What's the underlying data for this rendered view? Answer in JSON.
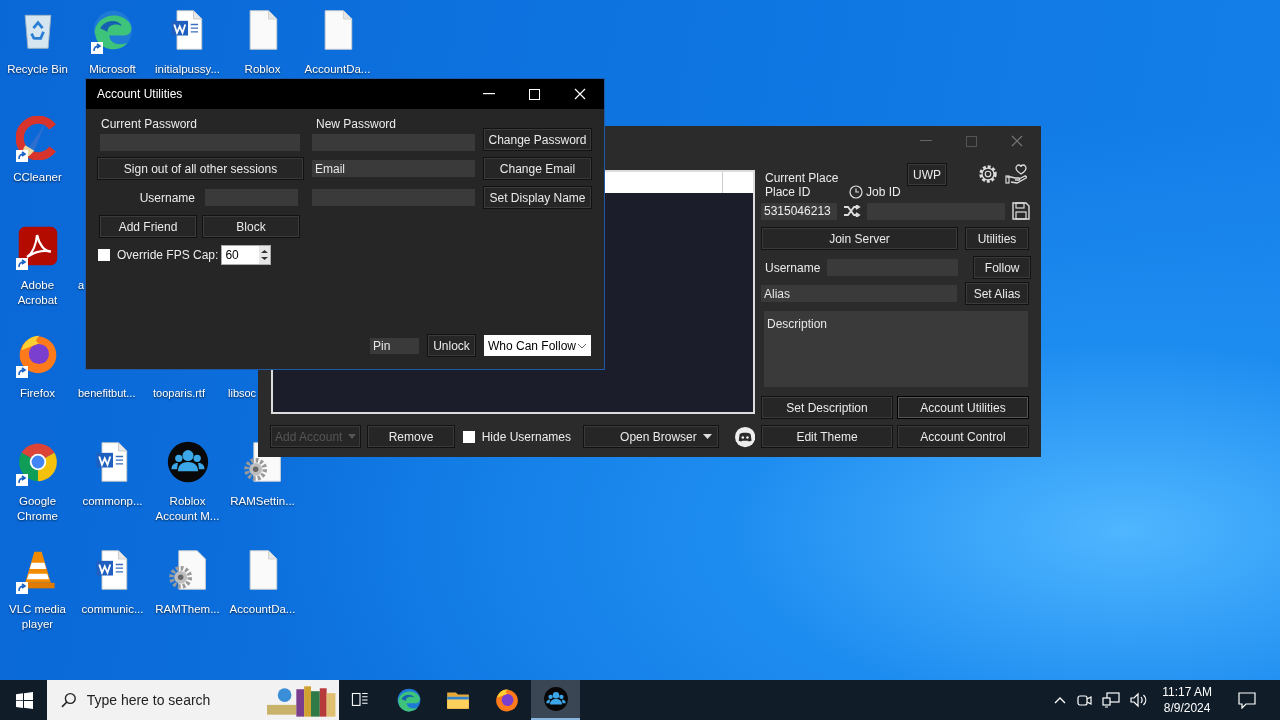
{
  "desktop": {
    "columns": [
      [
        {
          "label": "Recycle Bin",
          "kind": "recycle-bin"
        },
        {
          "label": "CCleaner",
          "kind": "ccleaner",
          "shortcut": true
        },
        {
          "label": "Adobe Acrobat",
          "kind": "acrobat",
          "shortcut": true
        },
        {
          "label": "Firefox",
          "kind": "firefox",
          "shortcut": true
        },
        {
          "label": "Google Chrome",
          "kind": "chrome",
          "shortcut": true
        },
        {
          "label": "VLC media player",
          "kind": "vlc",
          "shortcut": true
        }
      ],
      [
        {
          "label": "Microsoft",
          "kind": "edge",
          "shortcut": true
        },
        {
          "kind": "hidden"
        },
        {
          "label": "a",
          "kind": "hidden"
        },
        {
          "label": "benefitbut...",
          "kind": "hidden"
        },
        {
          "label": "commonp...",
          "kind": "word"
        },
        {
          "label": "communic...",
          "kind": "word"
        }
      ],
      [
        {
          "label": "initialpussy...",
          "kind": "word"
        },
        {
          "kind": "hidden"
        },
        {
          "kind": "hidden"
        },
        {
          "label": "tooparis.rtf",
          "kind": "hidden"
        },
        {
          "label": "Roblox Account M...",
          "kind": "people"
        },
        {
          "label": "RAMThem...",
          "kind": "gear-doc"
        }
      ],
      [
        {
          "label": "Roblox",
          "kind": "doc"
        },
        {
          "kind": "hidden"
        },
        {
          "kind": "hidden"
        },
        {
          "label": "libsoc",
          "kind": "hidden"
        },
        {
          "label": "RAMSettin...",
          "kind": "gear-doc"
        },
        {
          "label": "AccountDa...",
          "kind": "doc"
        }
      ],
      [
        {
          "label": "AccountDa...",
          "kind": "doc"
        }
      ]
    ]
  },
  "main_window": {
    "current_place_label": "Current Place",
    "uwp_button": "UWP",
    "place_id_label": "Place ID",
    "job_id_label": "Job ID",
    "place_id": "5315046213",
    "join_server": "Join Server",
    "utilities": "Utilities",
    "username_label": "Username",
    "follow": "Follow",
    "alias_placeholder": "Alias",
    "set_alias": "Set Alias",
    "description_placeholder": "Description",
    "set_description": "Set Description",
    "account_utilities": "Account Utilities",
    "add_account": {
      "label": "Add Account",
      "disabled": true
    },
    "remove": "Remove",
    "hide_usernames": {
      "label": "Hide Usernames",
      "checked": false
    },
    "open_browser": "Open Browser",
    "edit_theme": "Edit Theme",
    "account_control": "Account Control"
  },
  "utilities_window": {
    "title": "Account Utilities",
    "current_password_label": "Current Password",
    "new_password_label": "New Password",
    "change_password": "Change Password",
    "sign_out": "Sign out of all other sessions",
    "email_placeholder": "Email",
    "change_email": "Change Email",
    "username_label": "Username",
    "set_display_name": "Set Display Name",
    "add_friend": "Add Friend",
    "block": "Block",
    "override_fps": {
      "label": "Override FPS Cap:",
      "checked": false
    },
    "fps_cap": "60",
    "pin_placeholder": "Pin",
    "unlock": "Unlock",
    "who_can_follow": "Who Can Follow"
  },
  "taskbar": {
    "search_placeholder": "Type here to search",
    "apps": [
      {
        "kind": "task-view",
        "selected": false
      },
      {
        "kind": "edge",
        "selected": false
      },
      {
        "kind": "folder",
        "selected": false
      },
      {
        "kind": "firefox",
        "selected": false
      },
      {
        "kind": "people",
        "selected": true
      }
    ],
    "time": "11:17 AM",
    "date": "8/9/2024"
  }
}
